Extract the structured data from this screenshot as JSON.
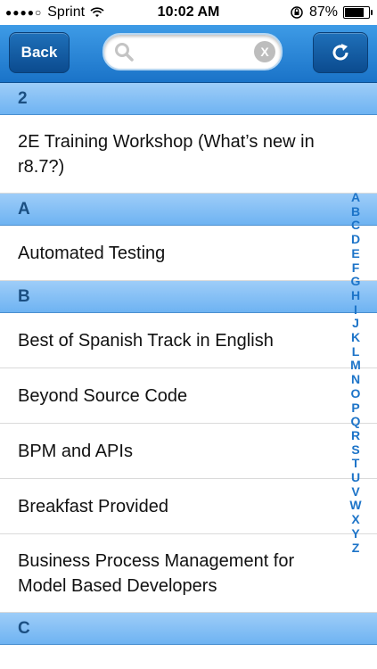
{
  "status_bar": {
    "signal_dots": "●●●●○",
    "carrier": "Sprint",
    "time": "10:02 AM",
    "battery_percent": "87%",
    "battery_level": 0.87
  },
  "nav": {
    "back_label": "Back",
    "search_value": "",
    "search_placeholder": "",
    "clear_label": "X"
  },
  "sections": [
    {
      "header": "2",
      "items": [
        "2E Training Workshop (What’s new in r8.7?)"
      ]
    },
    {
      "header": "A",
      "items": [
        "Automated Testing"
      ]
    },
    {
      "header": "B",
      "items": [
        "Best of Spanish Track in English",
        "Beyond Source Code",
        "BPM and APIs",
        "Breakfast Provided",
        "Business Process Management for Model Based Developers"
      ]
    },
    {
      "header": "C",
      "items": []
    }
  ],
  "index_letters": [
    "A",
    "B",
    "C",
    "D",
    "E",
    "F",
    "G",
    "H",
    "I",
    "J",
    "K",
    "L",
    "M",
    "N",
    "O",
    "P",
    "Q",
    "R",
    "S",
    "T",
    "U",
    "V",
    "W",
    "X",
    "Y",
    "Z"
  ],
  "colors": {
    "nav_blue": "#1a73c8",
    "section_blue": "#8cc3f6",
    "index_blue": "#1d74c8"
  }
}
